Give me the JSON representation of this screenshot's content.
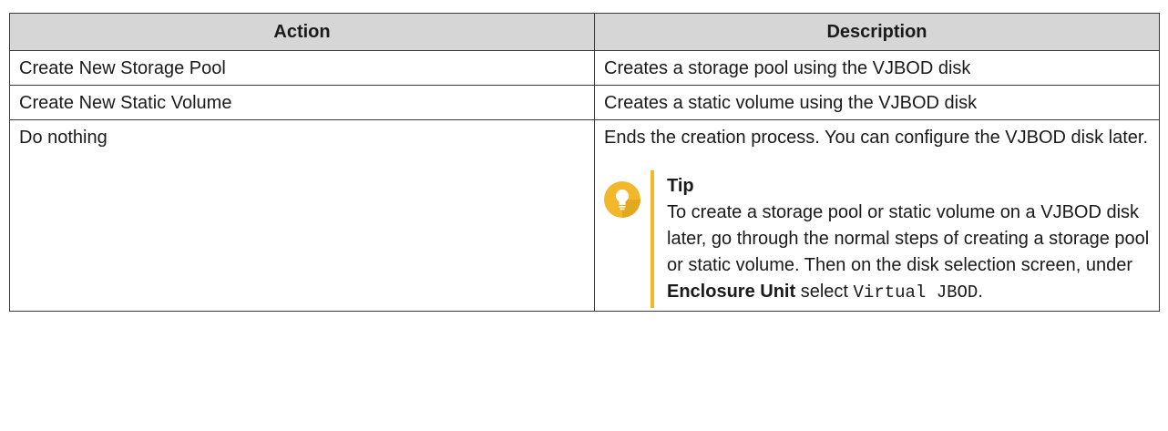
{
  "table": {
    "headers": [
      "Action",
      "Description"
    ],
    "rows": [
      {
        "action": "Create New Storage Pool",
        "description": "Creates a storage pool using the VJBOD disk"
      },
      {
        "action": "Create New Static Volume",
        "description": "Creates a static volume using the VJBOD disk"
      },
      {
        "action": "Do nothing",
        "description": "Ends the creation process. You can configure the VJBOD disk later."
      }
    ]
  },
  "tip": {
    "icon": "lightbulb-icon",
    "accent_color": "#f2b82c",
    "title": "Tip",
    "text_1": "To create a storage pool or static volume on a VJBOD disk later, go through the normal steps of creating a storage pool or static volume. Then on the disk selection screen, under",
    "bold_term": "Enclosure Unit",
    "text_2": "select",
    "code_value": "Virtual JBOD",
    "text_3": "."
  }
}
